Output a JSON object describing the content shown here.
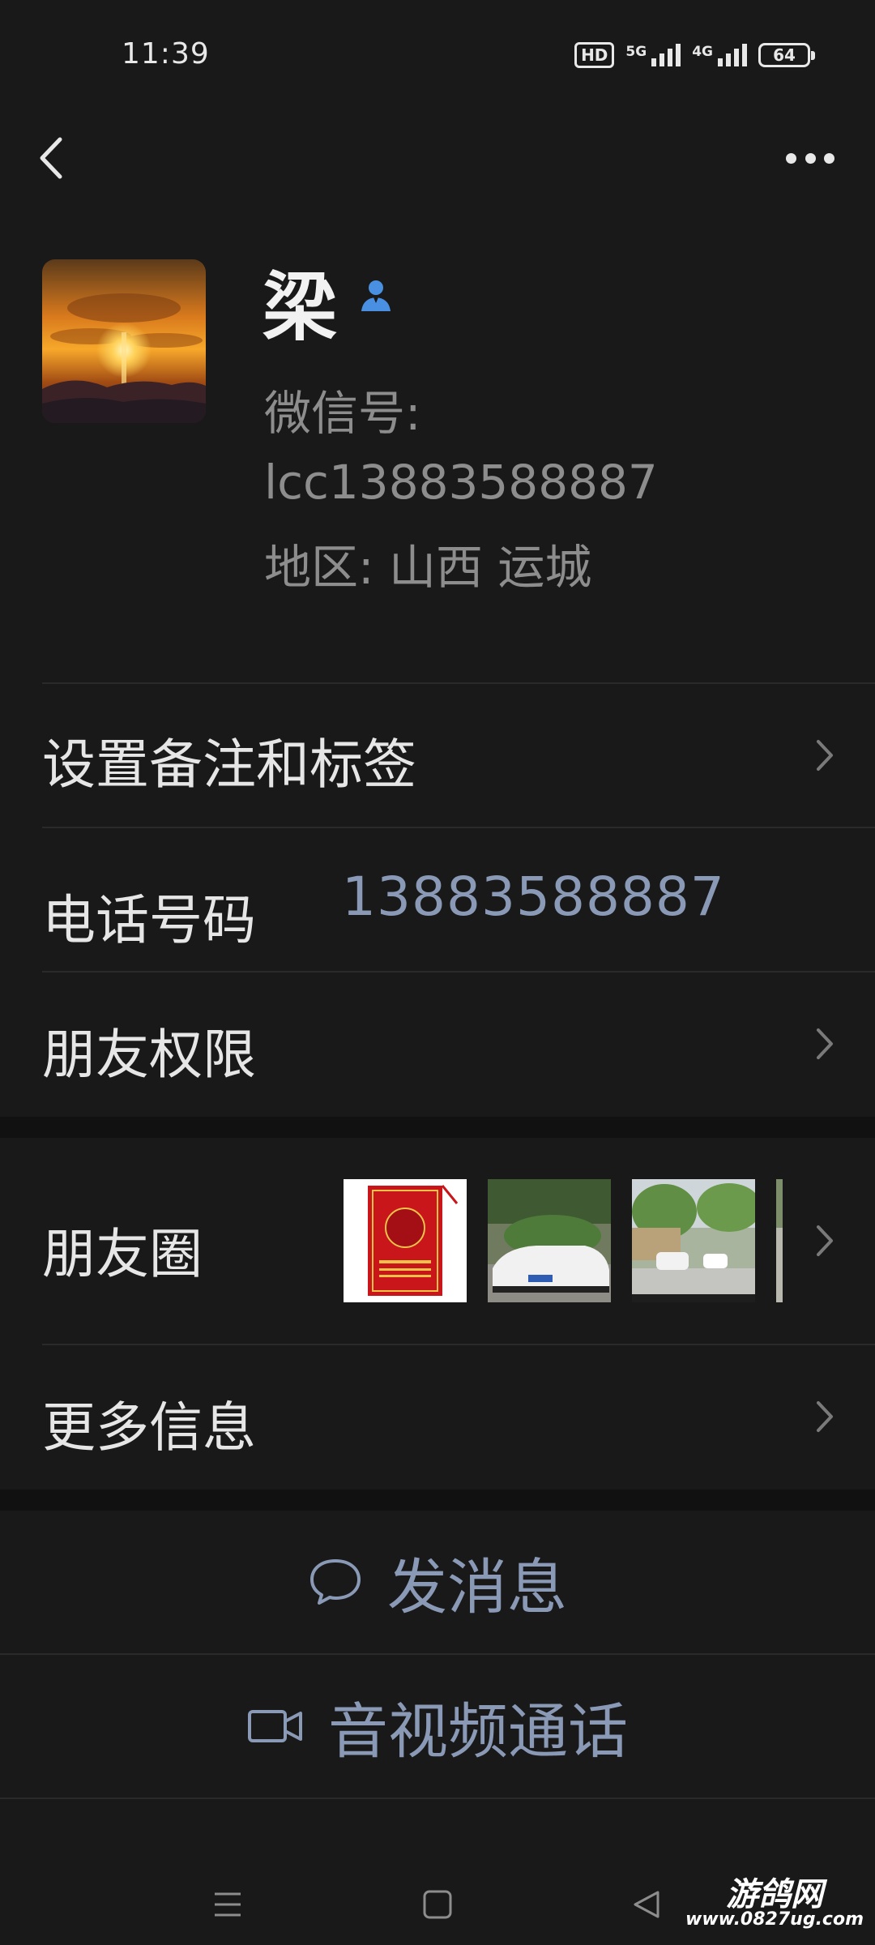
{
  "status_bar": {
    "time": "11:39",
    "hd": "HD",
    "net1": "5G",
    "net2": "4G",
    "battery": "64"
  },
  "icons": {
    "back": "back-arrow-icon",
    "more": "more-dots-icon",
    "verify": "person-badge-icon",
    "chevron": "chevron-right-icon",
    "message": "chat-bubble-icon",
    "video": "video-camera-icon",
    "nav_menu": "menu-icon",
    "nav_home": "square-home-icon",
    "nav_back": "triangle-back-icon"
  },
  "profile": {
    "name": "梁",
    "wechat_label": "微信号:",
    "wechat_id": "lcc13883588887",
    "region": "地区: 山西  运城"
  },
  "rows": {
    "remark": "设置备注和标签",
    "phone_label": "电话号码",
    "phone_value": "13883588887",
    "permissions": "朋友权限",
    "moments": "朋友圈",
    "more_info": "更多信息"
  },
  "actions": {
    "message": "发消息",
    "call": "音视频通话"
  },
  "watermark": {
    "top": "游鸽网",
    "bottom": "www.0827ug.com"
  },
  "colors": {
    "background": "#191919",
    "accent": "#8a9ab6",
    "verify": "#4a90e2"
  }
}
